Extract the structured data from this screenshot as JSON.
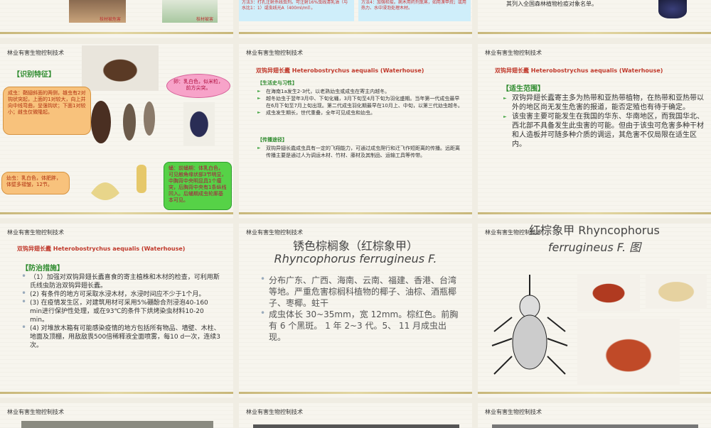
{
  "header_text": "林业有害生物控制技术",
  "top_row": {
    "slide1": {
      "caption1": "枝材被危害",
      "caption2": "枝材被害"
    },
    "slide2": {
      "method3": "方法3：打孔注射杀线虫剂。可注射16%虫线清乳油（与水比1：1）或虫线光A（400ml/ml）。",
      "method4": "方法4：加强检疫。病木用药剂熏蒸，如用溴甲烷；或用热力、水中浸泡处理木材。"
    },
    "slide3": {
      "text": "其列入全国森林植物检疫对象名单。"
    }
  },
  "slide_identify": {
    "section": "【识别特征】",
    "adult": "成虫：鞘翅斜面的两侧，雄虫有2对钩状突起，上面的1对较大，向上并向中线弯曲，呈强钩状；下面1对较小；雌虫仅微隆起。",
    "egg": "卵：乳白色，似米粒，前方尖突。",
    "larva": "幼虫：乳白色，体肥胖，体壁多褶皱，12节。",
    "pupa": "蛹：前蛹期：体乳白色，可见触角缘状部3节明显，中胸背中央明显具1个瘤突，后胸背中央有1条纵线凹入。后蛹期成虫轮廓基本可见。"
  },
  "slide_life": {
    "title": "双钩异翅长蠹 Heterobostrychus aequalis (Waterhouse)",
    "section1": "【生活史与习性】",
    "bullets1": [
      "在海南1a发生2-3代，以老熟幼虫或成虫在寄主内越冬。",
      "越冬幼虫于翌年3月中、下旬化蛹，3月下旬至4月下旬为羽化盛期。当年第一代成虫最早在6月下旬至7月上旬出现。第二代成虫羽化期最早在10月上、中旬，以第三代幼虫越冬。",
      "成虫发生期长，世代重叠，全年可见成虫和幼虫。"
    ],
    "section2": "【传播途径】",
    "bullets2": [
      "双钩异翅长蠹成虫具有一定的飞翔能力，可通过成虫爬行和迁飞作短距离的传播。远距离传播主要是通过人为调运木材、竹材、藤材及其制品、运输工具等传带。"
    ]
  },
  "slide_range": {
    "title": "双钩异翅长蠹 Heterobostrychus aequalis (Waterhouse)",
    "section": "【适生范围】",
    "bullets": [
      "双钩异翅长蠹寄主多为热带和亚热带植物，在热带和亚热带以外的地区尚无发生危害的报道，能否定殖也有待于确定。",
      "该虫害主要可能发生在我国的华东、华南地区，而我国华北、西北部不具备发生此虫害的可能。但由于该虫可危害多种干材和人造板并可随多种介质的调运，其危害不仅局限在适生区内。"
    ]
  },
  "slide_control": {
    "title": "双钩异翅长蠹 Heterobostrychus aequalis (Waterhouse)",
    "section": "【防治措施】",
    "bullets": [
      "（1）加强对双钩异翅长蠹喜食的寄主植株和木材的检查，可利用斯氏线虫防治双钩异翅长蠹。",
      "(2) 有条件的地方可采取水浸木材，水浸时间应不少于1个月。",
      "(3) 在疫情发生区，对建筑用材可采用5%硼酚合剂浸泡40-160 min进行保护性处理，或在93℃的条件下烘烤染虫材料10-20 min。",
      "(4) 对堆放木箱有可能感染疫情的地方包括所有物品、墙壁、木柱、地面及顶棚，用敌敌畏500倍稀释液全面喷雾，每10 d一次，连续3次。"
    ]
  },
  "slide_weevil": {
    "title_cn": "锈色棕榈象（红棕象甲）",
    "title_latin": "Rhyncophorus  ferrugineus  F.",
    "bullets": [
      "分布广东、广西、海南、云南、福建、香港、台湾等地。严重危害棕榈科植物的椰子、油棕、酒瓶椰子、枣椰。蛀干",
      "成虫体长 30~35mm，宽 12mm。棕红色。前胸有 6 个黑斑。 1 年 2~3 代。5、 11 月成虫出现。"
    ]
  },
  "slide_weevil_fig": {
    "title_line1": "红棕象甲 Rhyncophorus",
    "title_line2": "ferrugineus  F. 图"
  },
  "colors": {
    "accent_red": "#c0392b",
    "accent_green": "#2e8b2e",
    "bg": "#f7f5ee"
  }
}
